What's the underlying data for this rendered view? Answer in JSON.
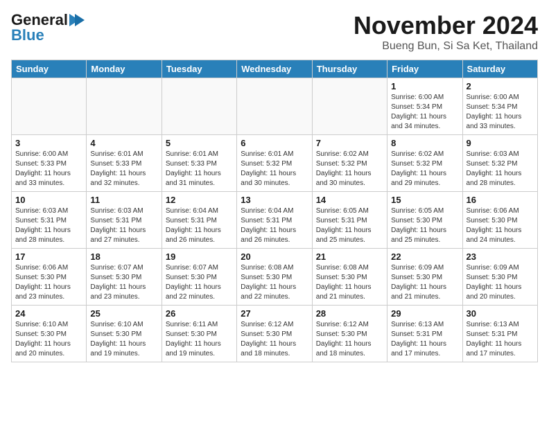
{
  "header": {
    "logo_general": "General",
    "logo_blue": "Blue",
    "month_title": "November 2024",
    "subtitle": "Bueng Bun, Si Sa Ket, Thailand"
  },
  "days_of_week": [
    "Sunday",
    "Monday",
    "Tuesday",
    "Wednesday",
    "Thursday",
    "Friday",
    "Saturday"
  ],
  "weeks": [
    [
      {
        "day": "",
        "info": ""
      },
      {
        "day": "",
        "info": ""
      },
      {
        "day": "",
        "info": ""
      },
      {
        "day": "",
        "info": ""
      },
      {
        "day": "",
        "info": ""
      },
      {
        "day": "1",
        "info": "Sunrise: 6:00 AM\nSunset: 5:34 PM\nDaylight: 11 hours\nand 34 minutes."
      },
      {
        "day": "2",
        "info": "Sunrise: 6:00 AM\nSunset: 5:34 PM\nDaylight: 11 hours\nand 33 minutes."
      }
    ],
    [
      {
        "day": "3",
        "info": "Sunrise: 6:00 AM\nSunset: 5:33 PM\nDaylight: 11 hours\nand 33 minutes."
      },
      {
        "day": "4",
        "info": "Sunrise: 6:01 AM\nSunset: 5:33 PM\nDaylight: 11 hours\nand 32 minutes."
      },
      {
        "day": "5",
        "info": "Sunrise: 6:01 AM\nSunset: 5:33 PM\nDaylight: 11 hours\nand 31 minutes."
      },
      {
        "day": "6",
        "info": "Sunrise: 6:01 AM\nSunset: 5:32 PM\nDaylight: 11 hours\nand 30 minutes."
      },
      {
        "day": "7",
        "info": "Sunrise: 6:02 AM\nSunset: 5:32 PM\nDaylight: 11 hours\nand 30 minutes."
      },
      {
        "day": "8",
        "info": "Sunrise: 6:02 AM\nSunset: 5:32 PM\nDaylight: 11 hours\nand 29 minutes."
      },
      {
        "day": "9",
        "info": "Sunrise: 6:03 AM\nSunset: 5:32 PM\nDaylight: 11 hours\nand 28 minutes."
      }
    ],
    [
      {
        "day": "10",
        "info": "Sunrise: 6:03 AM\nSunset: 5:31 PM\nDaylight: 11 hours\nand 28 minutes."
      },
      {
        "day": "11",
        "info": "Sunrise: 6:03 AM\nSunset: 5:31 PM\nDaylight: 11 hours\nand 27 minutes."
      },
      {
        "day": "12",
        "info": "Sunrise: 6:04 AM\nSunset: 5:31 PM\nDaylight: 11 hours\nand 26 minutes."
      },
      {
        "day": "13",
        "info": "Sunrise: 6:04 AM\nSunset: 5:31 PM\nDaylight: 11 hours\nand 26 minutes."
      },
      {
        "day": "14",
        "info": "Sunrise: 6:05 AM\nSunset: 5:31 PM\nDaylight: 11 hours\nand 25 minutes."
      },
      {
        "day": "15",
        "info": "Sunrise: 6:05 AM\nSunset: 5:30 PM\nDaylight: 11 hours\nand 25 minutes."
      },
      {
        "day": "16",
        "info": "Sunrise: 6:06 AM\nSunset: 5:30 PM\nDaylight: 11 hours\nand 24 minutes."
      }
    ],
    [
      {
        "day": "17",
        "info": "Sunrise: 6:06 AM\nSunset: 5:30 PM\nDaylight: 11 hours\nand 23 minutes."
      },
      {
        "day": "18",
        "info": "Sunrise: 6:07 AM\nSunset: 5:30 PM\nDaylight: 11 hours\nand 23 minutes."
      },
      {
        "day": "19",
        "info": "Sunrise: 6:07 AM\nSunset: 5:30 PM\nDaylight: 11 hours\nand 22 minutes."
      },
      {
        "day": "20",
        "info": "Sunrise: 6:08 AM\nSunset: 5:30 PM\nDaylight: 11 hours\nand 22 minutes."
      },
      {
        "day": "21",
        "info": "Sunrise: 6:08 AM\nSunset: 5:30 PM\nDaylight: 11 hours\nand 21 minutes."
      },
      {
        "day": "22",
        "info": "Sunrise: 6:09 AM\nSunset: 5:30 PM\nDaylight: 11 hours\nand 21 minutes."
      },
      {
        "day": "23",
        "info": "Sunrise: 6:09 AM\nSunset: 5:30 PM\nDaylight: 11 hours\nand 20 minutes."
      }
    ],
    [
      {
        "day": "24",
        "info": "Sunrise: 6:10 AM\nSunset: 5:30 PM\nDaylight: 11 hours\nand 20 minutes."
      },
      {
        "day": "25",
        "info": "Sunrise: 6:10 AM\nSunset: 5:30 PM\nDaylight: 11 hours\nand 19 minutes."
      },
      {
        "day": "26",
        "info": "Sunrise: 6:11 AM\nSunset: 5:30 PM\nDaylight: 11 hours\nand 19 minutes."
      },
      {
        "day": "27",
        "info": "Sunrise: 6:12 AM\nSunset: 5:30 PM\nDaylight: 11 hours\nand 18 minutes."
      },
      {
        "day": "28",
        "info": "Sunrise: 6:12 AM\nSunset: 5:30 PM\nDaylight: 11 hours\nand 18 minutes."
      },
      {
        "day": "29",
        "info": "Sunrise: 6:13 AM\nSunset: 5:31 PM\nDaylight: 11 hours\nand 17 minutes."
      },
      {
        "day": "30",
        "info": "Sunrise: 6:13 AM\nSunset: 5:31 PM\nDaylight: 11 hours\nand 17 minutes."
      }
    ]
  ]
}
